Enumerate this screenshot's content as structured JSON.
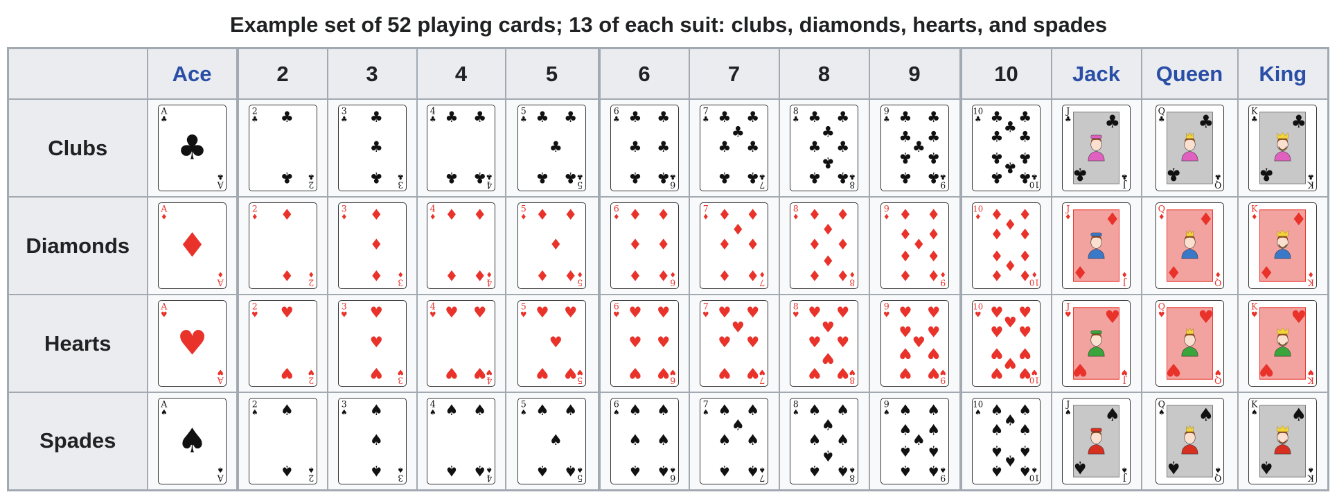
{
  "caption": "Example set of 52 playing cards; 13 of each suit: clubs, diamonds, hearts, and spades",
  "colors": {
    "red_suit": "#e8322a",
    "black_suit": "#111111",
    "link": "#2a4ea6",
    "header_bg": "#eaecf0",
    "cell_bg": "#f8f9fa",
    "border": "#a2a9b1",
    "face_panel_red": "#f2a3a0",
    "face_panel_black": "#c8c8c8"
  },
  "columns": [
    {
      "label": "Ace",
      "rank": "A",
      "is_link": true
    },
    {
      "label": "2",
      "rank": "2",
      "is_link": false
    },
    {
      "label": "3",
      "rank": "3",
      "is_link": false
    },
    {
      "label": "4",
      "rank": "4",
      "is_link": false
    },
    {
      "label": "5",
      "rank": "5",
      "is_link": false
    },
    {
      "label": "6",
      "rank": "6",
      "is_link": false
    },
    {
      "label": "7",
      "rank": "7",
      "is_link": false
    },
    {
      "label": "8",
      "rank": "8",
      "is_link": false
    },
    {
      "label": "9",
      "rank": "9",
      "is_link": false
    },
    {
      "label": "10",
      "rank": "10",
      "is_link": false
    },
    {
      "label": "Jack",
      "rank": "J",
      "is_link": true
    },
    {
      "label": "Queen",
      "rank": "Q",
      "is_link": true
    },
    {
      "label": "King",
      "rank": "K",
      "is_link": true
    }
  ],
  "rows": [
    {
      "label": "Clubs",
      "suit": "clubs",
      "symbol": "♣",
      "color": "black",
      "figure_color": "#e060c0"
    },
    {
      "label": "Diamonds",
      "suit": "diamonds",
      "symbol": "♦",
      "color": "red",
      "figure_color": "#3a78c8"
    },
    {
      "label": "Hearts",
      "suit": "hearts",
      "symbol": "♥",
      "color": "red",
      "figure_color": "#3aa53a"
    },
    {
      "label": "Spades",
      "suit": "spades",
      "symbol": "♠",
      "color": "black",
      "figure_color": "#d83020"
    }
  ]
}
